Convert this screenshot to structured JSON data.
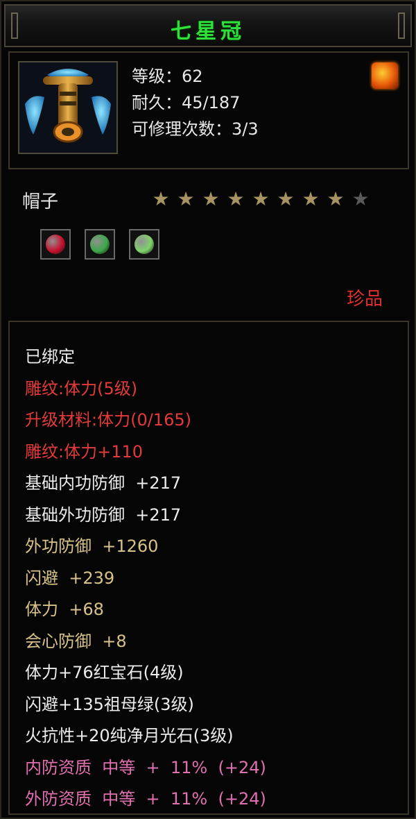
{
  "title": "七星冠",
  "stats": {
    "level": "等级：62",
    "durability": "耐久：45/187",
    "repair": "可修理次数：3/3"
  },
  "item_type": "帽子",
  "stars": {
    "filled": 8,
    "total": 9
  },
  "gems": [
    {
      "name": "red-gem-icon",
      "color": "#c8102e"
    },
    {
      "name": "jade-ring-icon",
      "color": "#3da84a"
    },
    {
      "name": "green-crystal-icon",
      "color": "#7fd36a"
    }
  ],
  "rarity": "珍品",
  "details": [
    {
      "text": "已绑定",
      "style": "white"
    },
    {
      "text": "雕纹:体力(5级)",
      "style": "red"
    },
    {
      "text": "升级材料:体力(0/165)",
      "style": "red"
    },
    {
      "text": "雕纹:体力+110",
      "style": "red"
    },
    {
      "text": "基础内功防御  +217",
      "style": "white"
    },
    {
      "text": "基础外功防御  +217",
      "style": "white"
    },
    {
      "text": "外功防御  +1260",
      "style": "gold"
    },
    {
      "text": "闪避  +239",
      "style": "gold"
    },
    {
      "text": "体力  +68",
      "style": "gold"
    },
    {
      "text": "会心防御  +8",
      "style": "gold"
    },
    {
      "text": "体力+76红宝石(4级)",
      "style": "white"
    },
    {
      "text": "闪避+135祖母绿(3级)",
      "style": "white"
    },
    {
      "text": "火抗性+20纯净月光石(3级)",
      "style": "white"
    },
    {
      "text": "内防资质  中等  +  11%  (+24)",
      "style": "pink"
    },
    {
      "text": "外防资质  中等  +  11%  (+24)",
      "style": "pink"
    }
  ]
}
